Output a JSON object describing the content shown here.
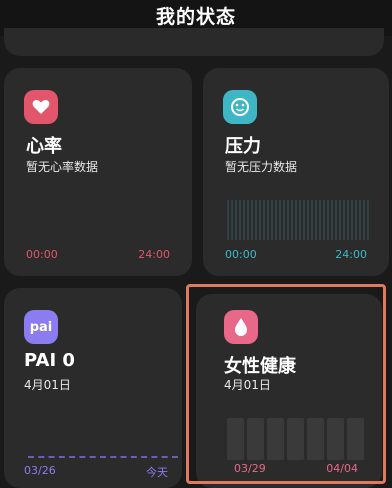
{
  "header": {
    "title": "我的状态"
  },
  "heart_card": {
    "title": "心率",
    "subtitle": "暂无心率数据",
    "time_start": "00:00",
    "time_end": "24:00",
    "icon": "heart-icon",
    "accent": "#e1566b"
  },
  "stress_card": {
    "title": "压力",
    "subtitle": "暂无压力数据",
    "time_start": "00:00",
    "time_end": "24:00",
    "icon": "smiley-face-icon",
    "accent": "#3fb6c6"
  },
  "pai_card": {
    "title": "PAI 0",
    "subtitle": "4月01日",
    "icon_text": "pai",
    "date_start": "03/26",
    "date_end": "今天",
    "accent": "#8b7cf0"
  },
  "female_card": {
    "title": "女性健康",
    "subtitle": "4月01日",
    "date_start": "03/29",
    "date_end": "04/04",
    "icon": "drop-icon",
    "accent": "#e8688a"
  }
}
